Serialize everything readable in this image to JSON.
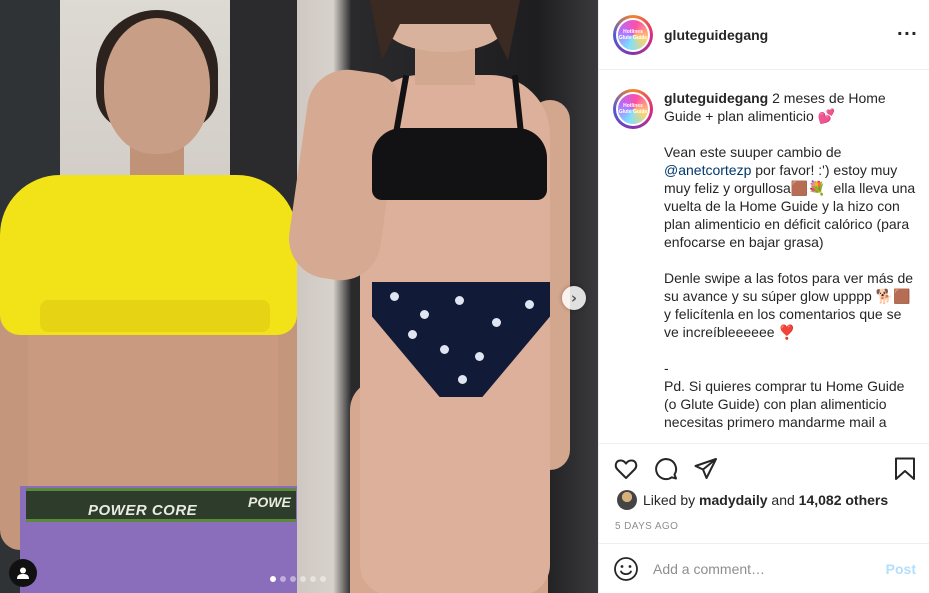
{
  "post": {
    "username": "gluteguidegang",
    "avatar_text": "Hotlines Glute Guide",
    "more_icon": "···",
    "carousel": {
      "total_images": 6,
      "active_index": 0,
      "next_arrow": "›"
    },
    "caption": {
      "username": "gluteguidegang",
      "text_intro": " 2 meses de Home Guide + plan alimenticio 💕\n\nVean este suuper cambio de ",
      "mention": "@anetcortezp",
      "text_body": " por favor! :') estoy muy muy feliz y orgullosa🟫💐  ella lleva una vuelta de la Home Guide y la hizo con plan alimenticio en déficit calórico (para enfocarse en bajar grasa)\n\nDenle swipe a las fotos para ver más de su avance y su súper glow upppp 🐕🟫 y felicítenla en los comentarios que se ve increíbleeeeee ❣️\n\n-\nPd. Si quieres comprar tu Home Guide (o Glute Guide) con plan alimenticio necesitas primero mandarme mail a"
    },
    "likes": {
      "prefix": "Liked by ",
      "user": "madydaily",
      "middle": " and ",
      "count": "14,082 others"
    },
    "time_ago": "5 DAYS AGO",
    "comment": {
      "placeholder": "Add a comment…",
      "post_label": "Post"
    },
    "shorts_text": "POWER CORE",
    "shorts_text_2": "POWE"
  },
  "colors": {
    "shirt": "#f2e218",
    "link": "#00376b",
    "post_disabled": "#b2dffc",
    "meta_gray": "#8e8e8e"
  },
  "icons": [
    "heart-icon",
    "comment-icon",
    "share-icon",
    "bookmark-icon",
    "emoji-icon",
    "user-tag-icon",
    "chevron-right-icon",
    "more-icon"
  ]
}
